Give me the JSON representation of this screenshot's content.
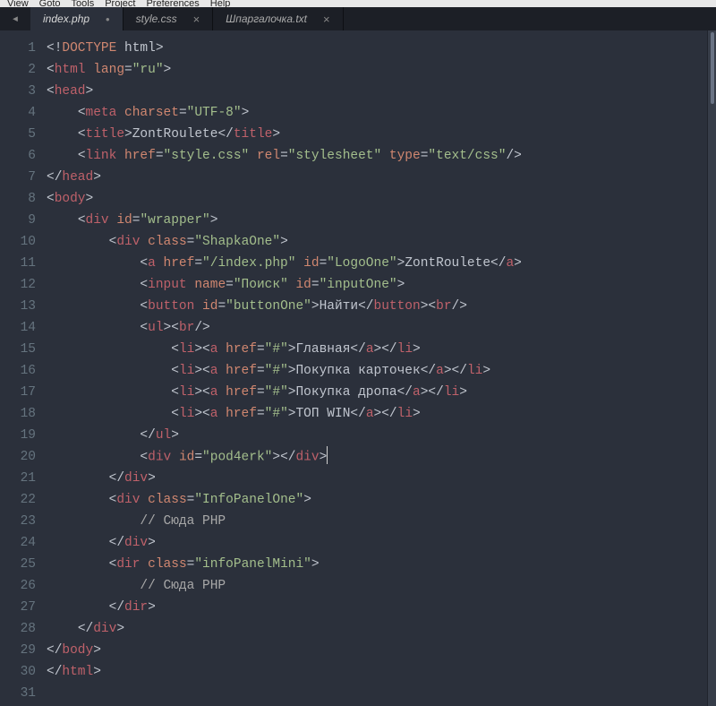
{
  "menubar": {
    "items": [
      "View",
      "Goto",
      "Tools",
      "Project",
      "Preferences",
      "Help"
    ]
  },
  "tabs": [
    {
      "label": "index.php",
      "active": true,
      "closeable": false,
      "modified": true
    },
    {
      "label": "style.css",
      "active": false,
      "closeable": true,
      "modified": false
    },
    {
      "label": "Шпаргалочка.txt",
      "active": false,
      "closeable": true,
      "modified": false
    }
  ],
  "gutter": {
    "start": 1,
    "end": 31
  },
  "code": {
    "lines": [
      [
        [
          "p",
          "<!"
        ],
        [
          "doc",
          "DOCTYPE"
        ],
        [
          "txt",
          " html"
        ],
        [
          "p",
          ">"
        ]
      ],
      [
        [
          "p",
          "<"
        ],
        [
          "tag",
          "html"
        ],
        [
          "txt",
          " "
        ],
        [
          "attr",
          "lang"
        ],
        [
          "p",
          "="
        ],
        [
          "str",
          "\"ru\""
        ],
        [
          "p",
          ">"
        ]
      ],
      [
        [
          "p",
          "<"
        ],
        [
          "tag",
          "head"
        ],
        [
          "p",
          ">"
        ]
      ],
      [
        [
          "txt",
          "    "
        ],
        [
          "p",
          "<"
        ],
        [
          "tag",
          "meta"
        ],
        [
          "txt",
          " "
        ],
        [
          "attr",
          "charset"
        ],
        [
          "p",
          "="
        ],
        [
          "str",
          "\"UTF-8\""
        ],
        [
          "p",
          ">"
        ]
      ],
      [
        [
          "txt",
          "    "
        ],
        [
          "p",
          "<"
        ],
        [
          "tag",
          "title"
        ],
        [
          "p",
          ">"
        ],
        [
          "txt",
          "ZontRoulete"
        ],
        [
          "p",
          "</"
        ],
        [
          "tag",
          "title"
        ],
        [
          "p",
          ">"
        ]
      ],
      [
        [
          "txt",
          "    "
        ],
        [
          "p",
          "<"
        ],
        [
          "tag",
          "link"
        ],
        [
          "txt",
          " "
        ],
        [
          "attr",
          "href"
        ],
        [
          "p",
          "="
        ],
        [
          "str",
          "\"style.css\""
        ],
        [
          "txt",
          " "
        ],
        [
          "attr",
          "rel"
        ],
        [
          "p",
          "="
        ],
        [
          "str",
          "\"stylesheet\""
        ],
        [
          "txt",
          " "
        ],
        [
          "attr",
          "type"
        ],
        [
          "p",
          "="
        ],
        [
          "str",
          "\"text/css\""
        ],
        [
          "p",
          "/>"
        ]
      ],
      [
        [
          "p",
          "</"
        ],
        [
          "tag",
          "head"
        ],
        [
          "p",
          ">"
        ]
      ],
      [
        [
          "p",
          "<"
        ],
        [
          "tag",
          "body"
        ],
        [
          "p",
          ">"
        ]
      ],
      [
        [
          "txt",
          "    "
        ],
        [
          "p",
          "<"
        ],
        [
          "tag",
          "div"
        ],
        [
          "txt",
          " "
        ],
        [
          "attr",
          "id"
        ],
        [
          "p",
          "="
        ],
        [
          "str",
          "\"wrapper\""
        ],
        [
          "p",
          ">"
        ]
      ],
      [
        [
          "txt",
          "        "
        ],
        [
          "p",
          "<"
        ],
        [
          "tag",
          "div"
        ],
        [
          "txt",
          " "
        ],
        [
          "attr",
          "class"
        ],
        [
          "p",
          "="
        ],
        [
          "str",
          "\"ShapkaOne\""
        ],
        [
          "p",
          ">"
        ]
      ],
      [
        [
          "txt",
          "            "
        ],
        [
          "p",
          "<"
        ],
        [
          "tag",
          "a"
        ],
        [
          "txt",
          " "
        ],
        [
          "attr",
          "href"
        ],
        [
          "p",
          "="
        ],
        [
          "str",
          "\"/index.php\""
        ],
        [
          "txt",
          " "
        ],
        [
          "attr",
          "id"
        ],
        [
          "p",
          "="
        ],
        [
          "str",
          "\"LogoOne\""
        ],
        [
          "p",
          ">"
        ],
        [
          "txt",
          "ZontRoulete"
        ],
        [
          "p",
          "</"
        ],
        [
          "tag",
          "a"
        ],
        [
          "p",
          ">"
        ]
      ],
      [
        [
          "txt",
          "            "
        ],
        [
          "p",
          "<"
        ],
        [
          "tag",
          "input"
        ],
        [
          "txt",
          " "
        ],
        [
          "attr",
          "name"
        ],
        [
          "p",
          "="
        ],
        [
          "str",
          "\"Поиск\""
        ],
        [
          "txt",
          " "
        ],
        [
          "attr",
          "id"
        ],
        [
          "p",
          "="
        ],
        [
          "str",
          "\"inputOne\""
        ],
        [
          "p",
          ">"
        ]
      ],
      [
        [
          "txt",
          "            "
        ],
        [
          "p",
          "<"
        ],
        [
          "tag",
          "button"
        ],
        [
          "txt",
          " "
        ],
        [
          "attr",
          "id"
        ],
        [
          "p",
          "="
        ],
        [
          "str",
          "\"buttonOne\""
        ],
        [
          "p",
          ">"
        ],
        [
          "txt",
          "Найти"
        ],
        [
          "p",
          "</"
        ],
        [
          "tag",
          "button"
        ],
        [
          "p",
          "><"
        ],
        [
          "tag",
          "br"
        ],
        [
          "p",
          "/>"
        ]
      ],
      [
        [
          "txt",
          "            "
        ],
        [
          "p",
          "<"
        ],
        [
          "tag",
          "ul"
        ],
        [
          "p",
          "><"
        ],
        [
          "tag",
          "br"
        ],
        [
          "p",
          "/>"
        ]
      ],
      [
        [
          "txt",
          "                "
        ],
        [
          "p",
          "<"
        ],
        [
          "tag",
          "li"
        ],
        [
          "p",
          "><"
        ],
        [
          "tag",
          "a"
        ],
        [
          "txt",
          " "
        ],
        [
          "attr",
          "href"
        ],
        [
          "p",
          "="
        ],
        [
          "str",
          "\"#\""
        ],
        [
          "p",
          ">"
        ],
        [
          "txt",
          "Главная"
        ],
        [
          "p",
          "</"
        ],
        [
          "tag",
          "a"
        ],
        [
          "p",
          "></"
        ],
        [
          "tag",
          "li"
        ],
        [
          "p",
          ">"
        ]
      ],
      [
        [
          "txt",
          "                "
        ],
        [
          "p",
          "<"
        ],
        [
          "tag",
          "li"
        ],
        [
          "p",
          "><"
        ],
        [
          "tag",
          "a"
        ],
        [
          "txt",
          " "
        ],
        [
          "attr",
          "href"
        ],
        [
          "p",
          "="
        ],
        [
          "str",
          "\"#\""
        ],
        [
          "p",
          ">"
        ],
        [
          "txt",
          "Покупка карточек"
        ],
        [
          "p",
          "</"
        ],
        [
          "tag",
          "a"
        ],
        [
          "p",
          "></"
        ],
        [
          "tag",
          "li"
        ],
        [
          "p",
          ">"
        ]
      ],
      [
        [
          "txt",
          "                "
        ],
        [
          "p",
          "<"
        ],
        [
          "tag",
          "li"
        ],
        [
          "p",
          "><"
        ],
        [
          "tag",
          "a"
        ],
        [
          "txt",
          " "
        ],
        [
          "attr",
          "href"
        ],
        [
          "p",
          "="
        ],
        [
          "str",
          "\"#\""
        ],
        [
          "p",
          ">"
        ],
        [
          "txt",
          "Покупка дропа"
        ],
        [
          "p",
          "</"
        ],
        [
          "tag",
          "a"
        ],
        [
          "p",
          "></"
        ],
        [
          "tag",
          "li"
        ],
        [
          "p",
          ">"
        ]
      ],
      [
        [
          "txt",
          "                "
        ],
        [
          "p",
          "<"
        ],
        [
          "tag",
          "li"
        ],
        [
          "p",
          "><"
        ],
        [
          "tag",
          "a"
        ],
        [
          "txt",
          " "
        ],
        [
          "attr",
          "href"
        ],
        [
          "p",
          "="
        ],
        [
          "str",
          "\"#\""
        ],
        [
          "p",
          ">"
        ],
        [
          "txt",
          "ТОП WIN"
        ],
        [
          "p",
          "</"
        ],
        [
          "tag",
          "a"
        ],
        [
          "p",
          "></"
        ],
        [
          "tag",
          "li"
        ],
        [
          "p",
          ">"
        ]
      ],
      [
        [
          "txt",
          "            "
        ],
        [
          "p",
          "</"
        ],
        [
          "tag",
          "ul"
        ],
        [
          "p",
          ">"
        ]
      ],
      [
        [
          "txt",
          "            "
        ],
        [
          "p",
          "<"
        ],
        [
          "tag",
          "div"
        ],
        [
          "txt",
          " "
        ],
        [
          "attr",
          "id"
        ],
        [
          "p",
          "="
        ],
        [
          "str",
          "\"pod4erk\""
        ],
        [
          "p",
          "></"
        ],
        [
          "tag",
          "div"
        ],
        [
          "p",
          ">"
        ]
      ],
      [
        [
          "txt",
          "        "
        ],
        [
          "p",
          "</"
        ],
        [
          "tag",
          "div"
        ],
        [
          "p",
          ">"
        ]
      ],
      [
        [
          "txt",
          "        "
        ],
        [
          "p",
          "<"
        ],
        [
          "tag",
          "div"
        ],
        [
          "txt",
          " "
        ],
        [
          "attr",
          "class"
        ],
        [
          "p",
          "="
        ],
        [
          "str",
          "\"InfoPanelOne\""
        ],
        [
          "p",
          ">"
        ]
      ],
      [
        [
          "txt",
          "            "
        ],
        [
          "cmt",
          "// Сюда PHP"
        ]
      ],
      [
        [
          "txt",
          "        "
        ],
        [
          "p",
          "</"
        ],
        [
          "tag",
          "div"
        ],
        [
          "p",
          ">"
        ]
      ],
      [
        [
          "txt",
          "        "
        ],
        [
          "p",
          "<"
        ],
        [
          "tag",
          "dir"
        ],
        [
          "txt",
          " "
        ],
        [
          "attr",
          "class"
        ],
        [
          "p",
          "="
        ],
        [
          "str",
          "\"infoPanelMini\""
        ],
        [
          "p",
          ">"
        ]
      ],
      [
        [
          "txt",
          "            "
        ],
        [
          "cmt",
          "// Сюда PHP"
        ]
      ],
      [
        [
          "txt",
          "        "
        ],
        [
          "p",
          "</"
        ],
        [
          "tag",
          "dir"
        ],
        [
          "p",
          ">"
        ]
      ],
      [
        [
          "txt",
          "    "
        ],
        [
          "p",
          "</"
        ],
        [
          "tag",
          "div"
        ],
        [
          "p",
          ">"
        ]
      ],
      [
        [
          "p",
          "</"
        ],
        [
          "tag",
          "body"
        ],
        [
          "p",
          ">"
        ]
      ],
      [
        [
          "p",
          "</"
        ],
        [
          "tag",
          "html"
        ],
        [
          "p",
          ">"
        ]
      ],
      []
    ],
    "cursor_line": 20
  }
}
